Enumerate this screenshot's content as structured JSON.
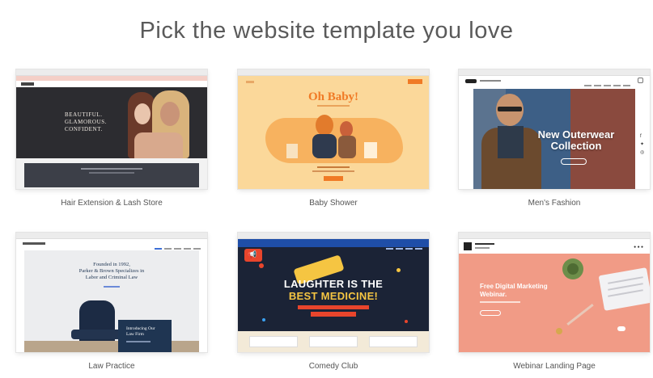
{
  "heading": "Pick the website template you love",
  "colors": {
    "hair_bg": "#2c2c30",
    "baby_bg": "#fbd89a",
    "baby_accent": "#f07a25",
    "men_blue": "#3d5f86",
    "law_navy": "#1f3552",
    "comedy_bg": "#1b2336",
    "comedy_yellow": "#f5c542",
    "comedy_red": "#e8452c",
    "webinar_bg": "#f19b86"
  },
  "templates": [
    {
      "label": "Hair Extension & Lash Store",
      "preview": {
        "headline_line1": "BEAUTIFUL.",
        "headline_line2": "GLAMOROUS.",
        "headline_line3": "CONFIDENT."
      }
    },
    {
      "label": "Baby Shower",
      "preview": {
        "headline": "Oh Baby!"
      }
    },
    {
      "label": "Men's Fashion",
      "preview": {
        "headline_line1": "New Outerwear",
        "headline_line2": "Collection"
      }
    },
    {
      "label": "Law Practice",
      "preview": {
        "headline_line1": "Founded in 1992,",
        "headline_line2": "Parker & Brown Specializes in",
        "headline_line3": "Labor and Criminal Law",
        "box_line1": "Introducing Our",
        "box_line2": "Law Firm"
      }
    },
    {
      "label": "Comedy Club",
      "preview": {
        "headline_line1": "LAUGHTER IS THE",
        "headline_line2": "BEST MEDICINE!"
      }
    },
    {
      "label": "Webinar Landing Page",
      "preview": {
        "headline_line1": "Free Digital Marketing",
        "headline_line2": "Webinar."
      }
    }
  ]
}
